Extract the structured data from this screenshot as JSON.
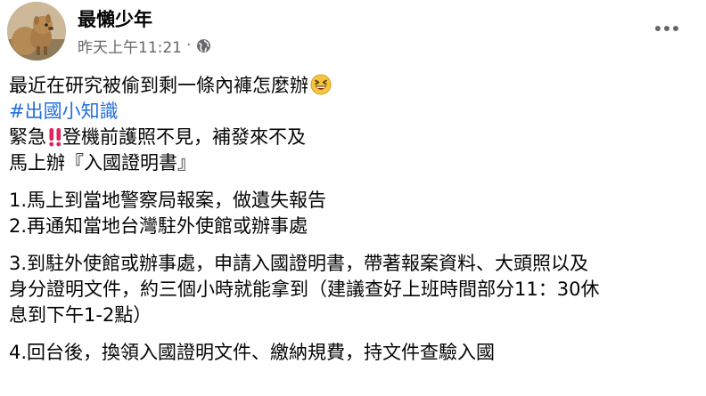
{
  "author": {
    "name": "最懶少年",
    "avatar_icon": "squirrel-avatar-photo"
  },
  "meta": {
    "timestamp": "昨天上午11:21",
    "separator": "·",
    "audience_icon": "globe-icon"
  },
  "more_icon": "more-dots-icon",
  "post": {
    "line1": "最近在研究被偷到剩一條內褲怎麼辦",
    "line1_emoji": "grinning-squinting-face",
    "hashtag": "#出國小知識",
    "line3_a": "緊急",
    "line3_emoji": "double-exclamation-mark",
    "line3_b": "登機前護照不見，補發來不及",
    "line4": "馬上辦『入國證明書』",
    "step1": "1.馬上到當地警察局報案，做遺失報告",
    "step2": "2.再通知當地台灣駐外使館或辦事處",
    "step3_line1": "3.到駐外使館或辦事處，申請入國證明書，帶著報案資料、大頭照以及",
    "step3_line2": "身分證明文件，約三個小時就能拿到（建議查好上班時間部分11：30休",
    "step3_line3": "息到下午1-2點）",
    "step4": "4.回台後，換領入國證明文件、繳納規費，持文件查驗入國"
  },
  "colors": {
    "text": "#050505",
    "secondary": "#65676b",
    "hashtag": "#216fdb",
    "exclamation": "#e0245e"
  }
}
